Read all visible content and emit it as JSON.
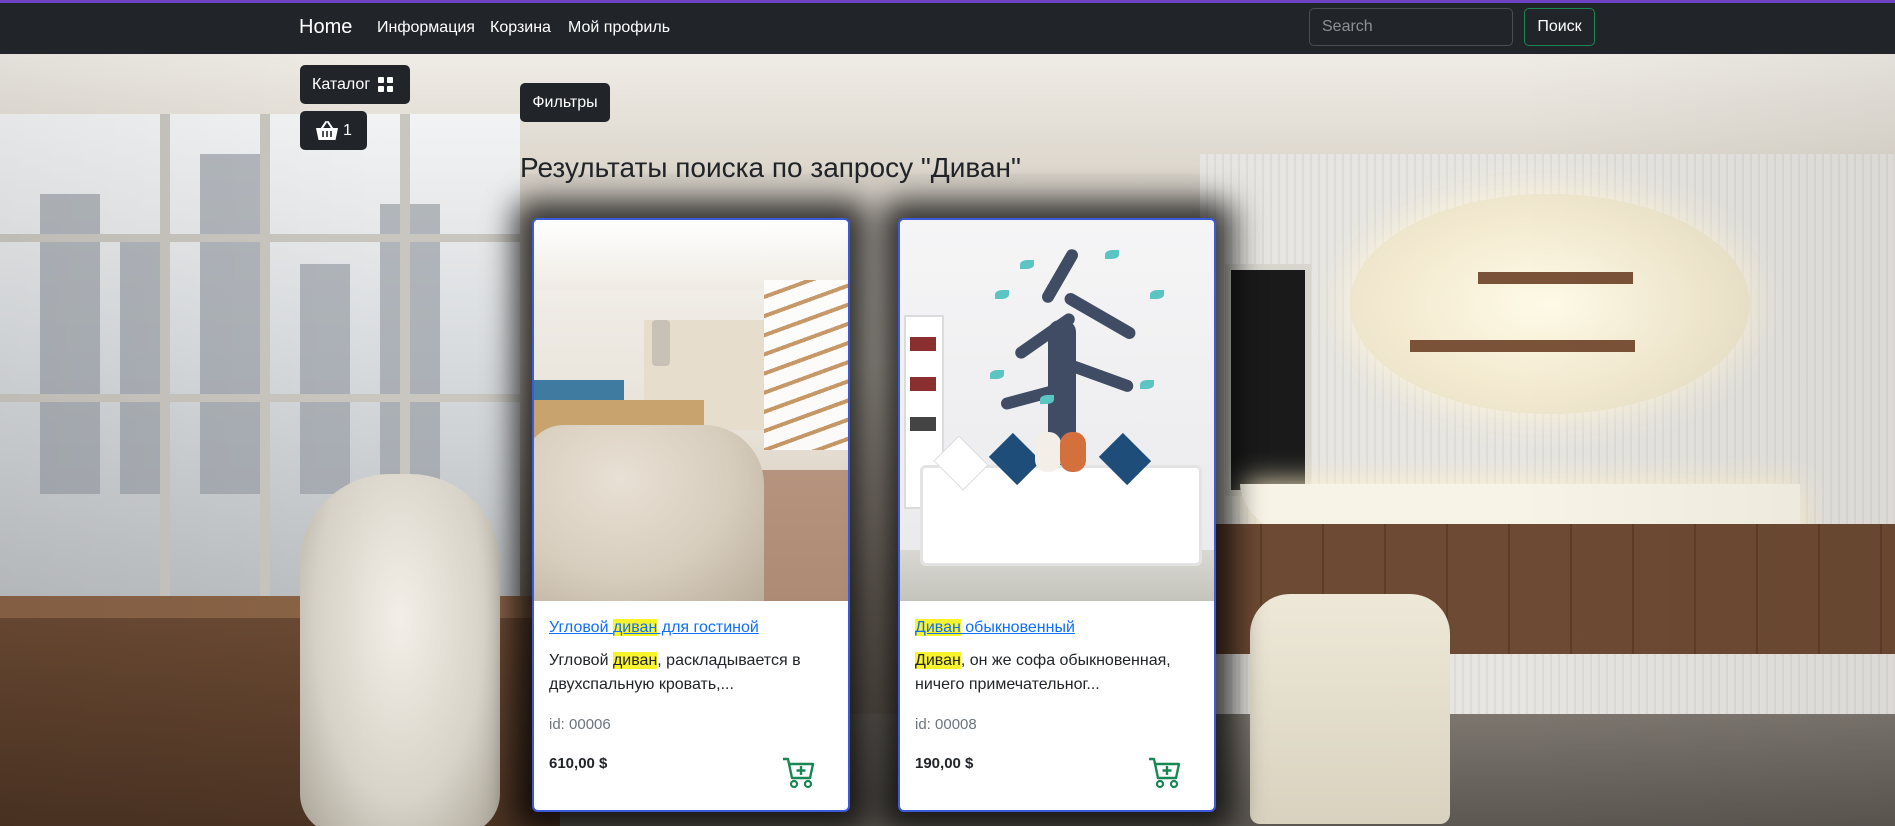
{
  "nav": {
    "brand": "Home",
    "links": [
      "Информация",
      "Корзина",
      "Мой профиль"
    ],
    "search_placeholder": "Search",
    "search_button": "Поиск"
  },
  "catalog_button": "Каталог",
  "cart_count": "1",
  "filters_button": "Фильтры",
  "results_title": "Результаты поиска по запросу \"Диван\"",
  "products": [
    {
      "title_pre": "Угловой ",
      "title_hl": "диван",
      "title_post": " для гостиной",
      "desc_pre": "Угловой ",
      "desc_hl": "диван",
      "desc_post": ", раскладывается в двухспальную кровать,...",
      "id": "id: 00006",
      "price": "610,00 $"
    },
    {
      "title_pre": "",
      "title_hl": "Диван",
      "title_post": " обыкновенный",
      "desc_pre": "",
      "desc_hl": "Диван",
      "desc_post": ", он же софа обыкновенная, ничего примечательног...",
      "id": "id: 00008",
      "price": "190,00 $"
    }
  ],
  "colors": {
    "navbar": "#212529",
    "accent_top": "#6f42c1",
    "search_border": "#198754",
    "card_border": "#3b5bdb",
    "highlight": "#f8f32b",
    "cart_icon": "#198754"
  },
  "icons": {
    "catalog": "grid-icon",
    "cart": "basket-icon",
    "add_to_cart": "cart-plus-icon"
  }
}
